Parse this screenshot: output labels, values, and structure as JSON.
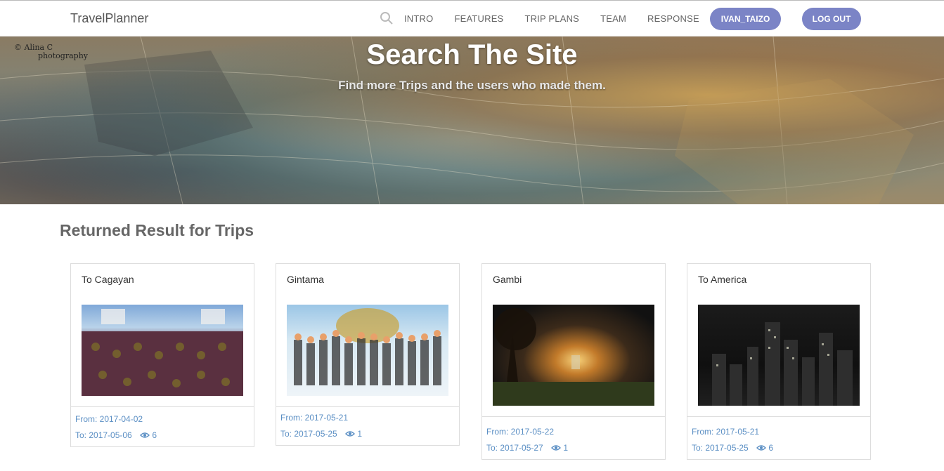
{
  "nav": {
    "brand": "TravelPlanner",
    "links": [
      "INTRO",
      "FEATURES",
      "TRIP PLANS",
      "TEAM",
      "RESPONSE"
    ],
    "user_button": "IVAN_TAIZO",
    "logout_button": "LOG OUT"
  },
  "hero": {
    "title": "Search The Site",
    "subtitle": "Find more Trips and the users who made them.",
    "watermark_line1": "© Alina C",
    "watermark_line2": "photography"
  },
  "results": {
    "heading": "Returned Result for Trips",
    "cards": [
      {
        "title": "To Cagayan",
        "from": "From: 2017-04-02",
        "to": "To: 2017-05-06",
        "views": "6",
        "image": "anime-army-scene"
      },
      {
        "title": "Gintama",
        "from": "From: 2017-05-21",
        "to": "To: 2017-05-25",
        "views": "1",
        "image": "anime-group-scene"
      },
      {
        "title": "Gambi",
        "from": "From: 2017-05-22",
        "to": "To: 2017-05-27",
        "views": "1",
        "image": "fantasy-sunset-landscape"
      },
      {
        "title": "To America",
        "from": "From: 2017-05-21",
        "to": "To: 2017-05-25",
        "views": "6",
        "image": "night-city-skyline"
      }
    ]
  },
  "colors": {
    "accent": "#7b84c6",
    "link_blue": "#5b8fc4"
  }
}
